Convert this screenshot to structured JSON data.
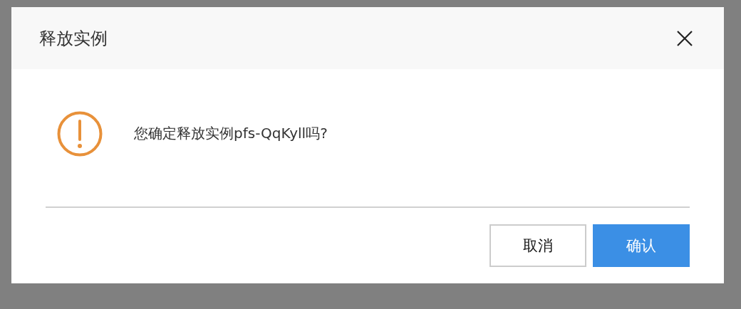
{
  "dialog": {
    "title": "释放实例",
    "message": "您确定释放实例pfs-QqKyll吗?",
    "buttons": [
      {
        "label": "取消",
        "kind": "secondary"
      },
      {
        "label": "确认",
        "kind": "primary"
      }
    ]
  }
}
